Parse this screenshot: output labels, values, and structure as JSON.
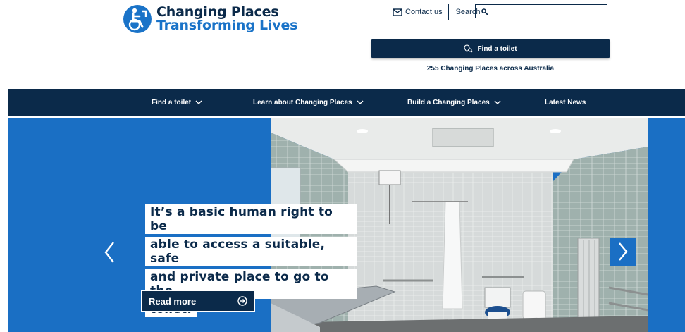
{
  "logo": {
    "line1": "Changing Places",
    "line2": "Transforming Lives"
  },
  "utility": {
    "contact_label": "Contact us",
    "search_label": "Search",
    "search_placeholder": ""
  },
  "find_button": {
    "label": "Find a toilet"
  },
  "count_text": "255 Changing Places across Australia",
  "nav": {
    "items": [
      {
        "label": "Find a toilet",
        "has_dropdown": true
      },
      {
        "label": "Learn about Changing Places",
        "has_dropdown": true
      },
      {
        "label": "Build a Changing Places",
        "has_dropdown": true
      },
      {
        "label": "Latest News",
        "has_dropdown": false
      }
    ]
  },
  "hero": {
    "headline_lines": [
      "It’s a basic human right to be",
      "able to access a suitable, safe",
      "and private place to go to the",
      "toilet."
    ],
    "cta_label": "Read more"
  },
  "colors": {
    "navy": "#0b2a4a",
    "blue": "#1a6fc4",
    "white": "#ffffff"
  },
  "icons": [
    "wheelchair-logo-icon",
    "envelope-icon",
    "search-icon",
    "location-search-icon",
    "chevron-down-icon",
    "arrow-circle-right-icon",
    "chevron-left-icon",
    "chevron-right-icon"
  ]
}
